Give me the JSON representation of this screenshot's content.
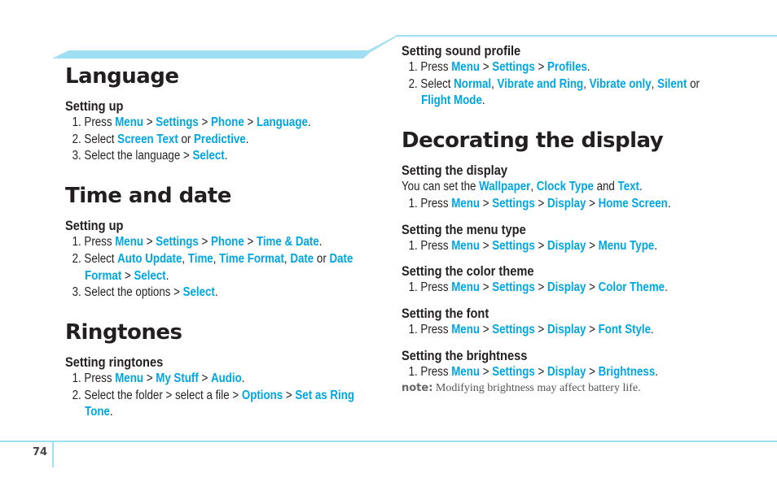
{
  "colors": {
    "accent": "#00a6e2",
    "band": "#9fdff4",
    "text": "#231f20"
  },
  "page_number": "74",
  "left": {
    "sections": [
      {
        "title": "Language",
        "subsections": [
          {
            "heading": "Setting up",
            "steps": [
              [
                {
                  "t": "1. "
                },
                {
                  "t": "Press "
                },
                {
                  "h": "Menu"
                },
                {
                  "t": " > "
                },
                {
                  "h": "Settings"
                },
                {
                  "t": " > "
                },
                {
                  "h": "Phone"
                },
                {
                  "t": " > "
                },
                {
                  "h": "Language"
                },
                {
                  "t": "."
                }
              ],
              [
                {
                  "t": "2. "
                },
                {
                  "t": "Select "
                },
                {
                  "h": "Screen Text"
                },
                {
                  "t": " or "
                },
                {
                  "h": "Predictive"
                },
                {
                  "t": "."
                }
              ],
              [
                {
                  "t": "3. "
                },
                {
                  "t": "Select the language > "
                },
                {
                  "h": "Select"
                },
                {
                  "t": "."
                }
              ]
            ]
          }
        ]
      },
      {
        "title": "Time and date",
        "subsections": [
          {
            "heading": "Setting up",
            "steps": [
              [
                {
                  "t": "1. "
                },
                {
                  "t": "Press "
                },
                {
                  "h": "Menu"
                },
                {
                  "t": " > "
                },
                {
                  "h": "Settings"
                },
                {
                  "t": " > "
                },
                {
                  "h": "Phone"
                },
                {
                  "t": " > "
                },
                {
                  "h": "Time & Date"
                },
                {
                  "t": "."
                }
              ],
              [
                {
                  "t": "2. "
                },
                {
                  "t": "Select "
                },
                {
                  "h": "Auto Update"
                },
                {
                  "t": ", "
                },
                {
                  "h": "Time"
                },
                {
                  "t": ", "
                },
                {
                  "h": "Time Format"
                },
                {
                  "t": ", "
                },
                {
                  "h": "Date"
                },
                {
                  "t": " or "
                },
                {
                  "h": "Date"
                }
              ],
              [
                {
                  "c": true
                },
                {
                  "h": "Format"
                },
                {
                  "t": " > "
                },
                {
                  "h": "Select"
                },
                {
                  "t": "."
                }
              ],
              [
                {
                  "t": "3. "
                },
                {
                  "t": "Select the options > "
                },
                {
                  "h": "Select"
                },
                {
                  "t": "."
                }
              ]
            ]
          }
        ]
      },
      {
        "title": "Ringtones",
        "subsections": [
          {
            "heading": "Setting ringtones",
            "steps": [
              [
                {
                  "t": "1. "
                },
                {
                  "t": "Press "
                },
                {
                  "h": "Menu"
                },
                {
                  "t": " > "
                },
                {
                  "h": "My Stuff"
                },
                {
                  "t": " > "
                },
                {
                  "h": "Audio"
                },
                {
                  "t": "."
                }
              ],
              [
                {
                  "t": "2. "
                },
                {
                  "t": "Select the folder > select a file > "
                },
                {
                  "h": "Options"
                },
                {
                  "t": " > "
                },
                {
                  "h": "Set as Ring"
                }
              ],
              [
                {
                  "c": true
                },
                {
                  "h": "Tone"
                },
                {
                  "t": "."
                }
              ]
            ]
          }
        ]
      }
    ]
  },
  "right": {
    "top_subsection": {
      "heading": "Setting sound profile",
      "steps": [
        [
          {
            "t": "1. "
          },
          {
            "t": "Press "
          },
          {
            "h": "Menu"
          },
          {
            "t": " > "
          },
          {
            "h": "Settings"
          },
          {
            "t": " > "
          },
          {
            "h": "Profiles"
          },
          {
            "t": "."
          }
        ],
        [
          {
            "t": "2. "
          },
          {
            "t": "Select "
          },
          {
            "h": "Normal"
          },
          {
            "t": ", "
          },
          {
            "h": "Vibrate and Ring"
          },
          {
            "t": ", "
          },
          {
            "h": "Vibrate only"
          },
          {
            "t": ", "
          },
          {
            "h": "Silent"
          },
          {
            "t": " or"
          }
        ],
        [
          {
            "c": true
          },
          {
            "h": "Flight Mode"
          },
          {
            "t": "."
          }
        ]
      ]
    },
    "section": {
      "title": "Decorating the display",
      "subsections": [
        {
          "heading": "Setting the display",
          "intro": [
            {
              "t": "You can set the "
            },
            {
              "h": "Wallpaper"
            },
            {
              "t": ", "
            },
            {
              "h": "Clock Type"
            },
            {
              "t": " and "
            },
            {
              "h": "Text"
            },
            {
              "t": "."
            }
          ],
          "steps": [
            [
              {
                "t": "1. "
              },
              {
                "t": "Press "
              },
              {
                "h": "Menu"
              },
              {
                "t": " > "
              },
              {
                "h": "Settings"
              },
              {
                "t": " > "
              },
              {
                "h": "Display"
              },
              {
                "t": " > "
              },
              {
                "h": "Home Screen"
              },
              {
                "t": "."
              }
            ]
          ]
        },
        {
          "heading": "Setting the menu type",
          "steps": [
            [
              {
                "t": "1. "
              },
              {
                "t": "Press "
              },
              {
                "h": "Menu"
              },
              {
                "t": " > "
              },
              {
                "h": "Settings"
              },
              {
                "t": " > "
              },
              {
                "h": "Display"
              },
              {
                "t": " > "
              },
              {
                "h": "Menu Type"
              },
              {
                "t": "."
              }
            ]
          ]
        },
        {
          "heading": "Setting the color theme",
          "steps": [
            [
              {
                "t": "1. "
              },
              {
                "t": "Press "
              },
              {
                "h": "Menu"
              },
              {
                "t": " > "
              },
              {
                "h": "Settings"
              },
              {
                "t": " > "
              },
              {
                "h": "Display"
              },
              {
                "t": " > "
              },
              {
                "h": "Color Theme"
              },
              {
                "t": "."
              }
            ]
          ]
        },
        {
          "heading": "Setting the font",
          "steps": [
            [
              {
                "t": "1. "
              },
              {
                "t": "Press "
              },
              {
                "h": "Menu"
              },
              {
                "t": " > "
              },
              {
                "h": "Settings"
              },
              {
                "t": " > "
              },
              {
                "h": "Display"
              },
              {
                "t": " > "
              },
              {
                "h": "Font Style"
              },
              {
                "t": "."
              }
            ]
          ]
        },
        {
          "heading": "Setting the brightness",
          "steps": [
            [
              {
                "t": "1. "
              },
              {
                "t": "Press "
              },
              {
                "h": "Menu"
              },
              {
                "t": " > "
              },
              {
                "h": "Settings"
              },
              {
                "t": " > "
              },
              {
                "h": "Display"
              },
              {
                "t": " > "
              },
              {
                "h": "Brightness"
              },
              {
                "t": "."
              }
            ]
          ],
          "note_label": "note:",
          "note_text": " Modifying brightness may affect battery life."
        }
      ]
    }
  }
}
